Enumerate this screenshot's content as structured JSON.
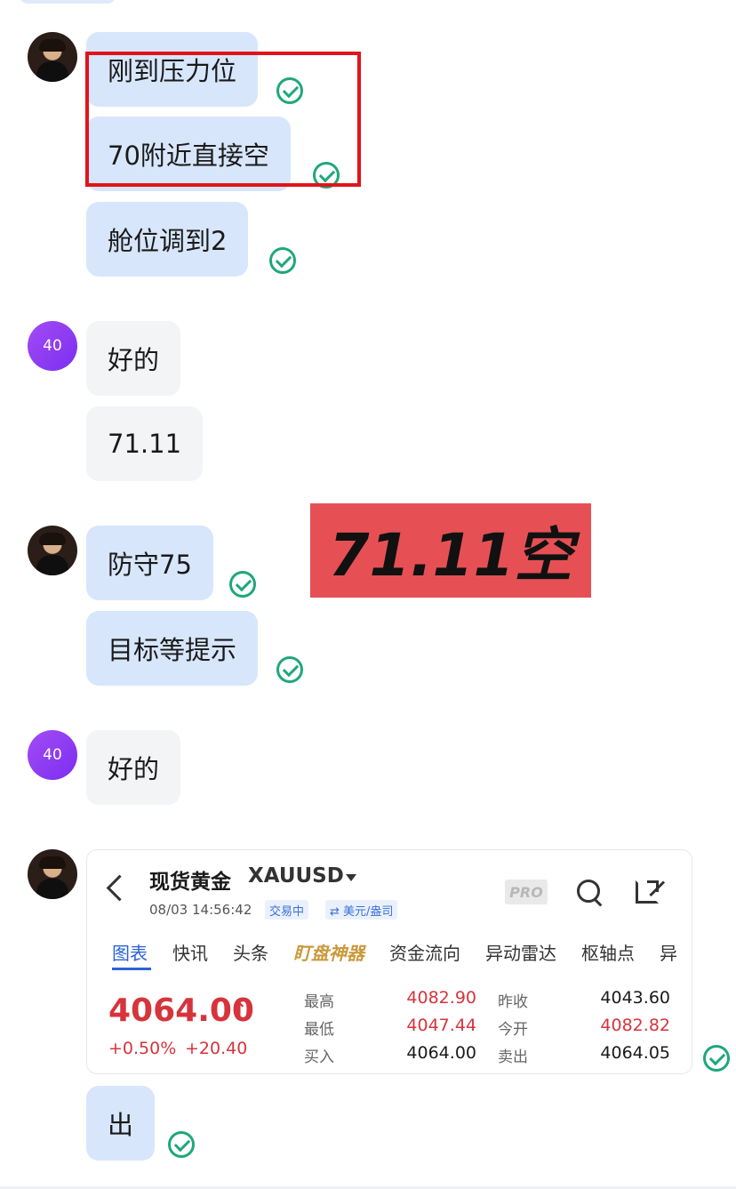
{
  "messages": [
    {
      "text": "刚到压力位"
    },
    {
      "text": "70附近直接空"
    },
    {
      "text": "舱位调到2"
    },
    {
      "text": "好的"
    },
    {
      "text": "71.11"
    },
    {
      "text": "防守75"
    },
    {
      "text": "目标等提示"
    },
    {
      "text": "好的"
    },
    {
      "text": "出"
    }
  ],
  "avatar_number": "40",
  "banner": "71.11空",
  "quote": {
    "name": "现货黄金",
    "code": "XAUUSD",
    "time": "08/03 14:56:42",
    "status_tag": "交易中",
    "currency_tag": "⇄ 美元/盎司",
    "pro_label": "PRO",
    "tabs": [
      "图表",
      "快讯",
      "头条",
      "盯盘神器",
      "资金流向",
      "异动雷达",
      "枢轴点",
      "异"
    ],
    "price": "4064.00",
    "arrow": "↑",
    "change_pct": "+0.50%",
    "change_abs": "+20.40",
    "stats": {
      "high_label": "最高",
      "high": "4082.90",
      "low_label": "最低",
      "low": "4047.44",
      "bid_label": "买入",
      "bid": "4064.00",
      "prev_close_label": "昨收",
      "prev_close": "4043.60",
      "open_label": "今开",
      "open": "4082.82",
      "ask_label": "卖出",
      "ask": "4064.05"
    }
  },
  "colors": {
    "sent_bubble": "#d7e6fb",
    "recv_bubble": "#f3f4f6",
    "check": "#1fa77b",
    "highlight_box": "#e0141b",
    "banner_bg": "#e65055",
    "price_up": "#d6343c",
    "tab_active": "#2a63d4"
  }
}
